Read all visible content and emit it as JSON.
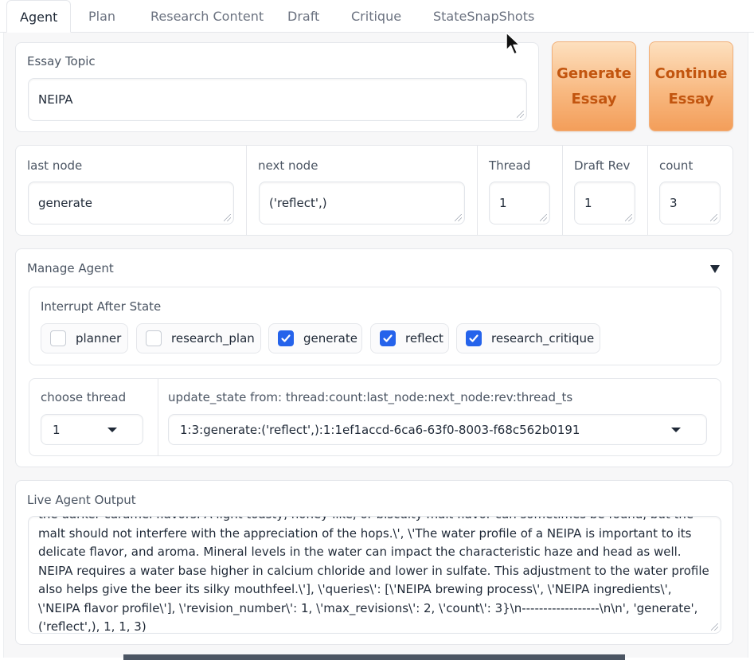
{
  "tabs": [
    "Agent",
    "Plan",
    "Research Content",
    "Draft",
    "Critique",
    "StateSnapShots"
  ],
  "topic": {
    "label": "Essay Topic",
    "value": "NEIPA"
  },
  "buttons": {
    "generate": "Generate\nEssay",
    "continue": "Continue\nEssay"
  },
  "status": {
    "last_node": {
      "label": "last node",
      "value": "generate"
    },
    "next_node": {
      "label": "next node",
      "value": "('reflect',)"
    },
    "thread": {
      "label": "Thread",
      "value": "1"
    },
    "draft_rev": {
      "label": "Draft Rev",
      "value": "1"
    },
    "count": {
      "label": "count",
      "value": "3"
    }
  },
  "manage": {
    "title": "Manage Agent",
    "interrupt_label": "Interrupt After State",
    "checkboxes": [
      {
        "label": "planner",
        "checked": false
      },
      {
        "label": "research_plan",
        "checked": false
      },
      {
        "label": "generate",
        "checked": true
      },
      {
        "label": "reflect",
        "checked": true
      },
      {
        "label": "research_critique",
        "checked": true
      }
    ],
    "choose_thread": {
      "label": "choose thread",
      "value": "1"
    },
    "update_state": {
      "label": "update_state from: thread:count:last_node:next_node:rev:thread_ts",
      "value": "1:3:generate:('reflect',):1:1ef1accd-6ca6-63f0-8003-f68c562b0191"
    }
  },
  "output": {
    "label": "Live Agent Output",
    "text": "the darker caramel flavors. A light toasty, honey-like, or biscuity malt flavor can sometimes be found, but the malt should not interfere with the appreciation of the hops.\\', \\'The water profile of a NEIPA is important to its delicate flavor, and aroma. Mineral levels in the water can impact the characteristic haze and head as well. NEIPA requires a water base higher in calcium chloride and lower in sulfate. This adjustment to the water profile also helps give the beer its silky mouthfeel.\\'], \\'queries\\': [\\'NEIPA brewing process\\', \\'NEIPA ingredients\\', \\'NEIPA flavor profile\\'], \\'revision_number\\': 1, \\'max_revisions\\': 2, \\'count\\': 3}\\n------------------\\n\\n', 'generate', ('reflect',), 1, 1, 3)"
  },
  "colors": {
    "accent": "#2563eb",
    "button_text": "#c2550f",
    "button_fill": "#f8b981"
  }
}
